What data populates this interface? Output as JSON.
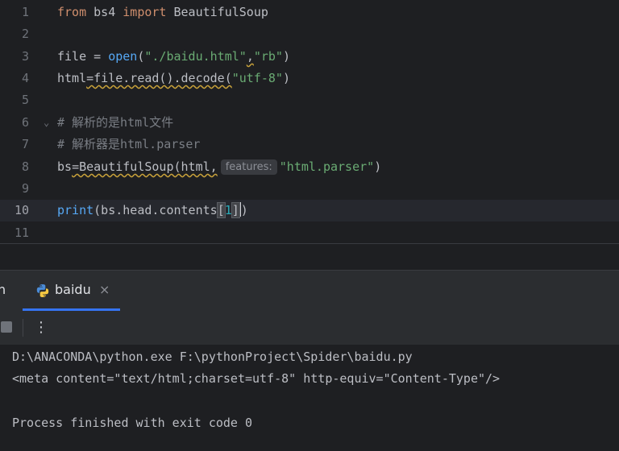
{
  "editor": {
    "line_numbers": [
      "1",
      "2",
      "3",
      "4",
      "5",
      "6",
      "7",
      "8",
      "9",
      "10",
      "11"
    ],
    "l1": {
      "kw_from": "from",
      "mod": " bs4 ",
      "kw_import": "import",
      "cls": " BeautifulSoup"
    },
    "l3": {
      "var": "file = ",
      "fn": "open",
      "p1": "(",
      "s1": "\"./baidu.html\"",
      "comma": ",",
      "s2": "\"rb\"",
      "p2": ")"
    },
    "l4": {
      "a": "html",
      "b": "=file.read().decode(",
      "s": "\"utf-8\"",
      "c": ")"
    },
    "l6": {
      "comment": "# 解析的是html文件"
    },
    "l7": {
      "comment": "# 解析器是html.parser"
    },
    "l8": {
      "a": "bs",
      "b": "=BeautifulSoup(html",
      "comma": ",",
      "hint": "features:",
      "s": "\"html.parser\"",
      "c": ")"
    },
    "l10": {
      "fn": "print",
      "a": "(bs.head.contents",
      "lb": "[",
      "num": "1",
      "rb": "]",
      "c": ")"
    }
  },
  "run_panel": {
    "partial_tab": "n",
    "tab_label": "baidu",
    "tab_close": "×",
    "more_label": "⋮"
  },
  "console": {
    "lines": [
      "D:\\ANACONDA\\python.exe F:\\pythonProject\\Spider\\baidu.py",
      "<meta content=\"text/html;charset=utf-8\" http-equiv=\"Content-Type\"/>",
      "",
      "Process finished with exit code 0"
    ]
  },
  "colors": {
    "keyword": "#cf8e6d",
    "string": "#6aab73",
    "function": "#56a8f5",
    "comment": "#7a7e85",
    "number": "#2aacb8",
    "accent": "#3574f0"
  }
}
